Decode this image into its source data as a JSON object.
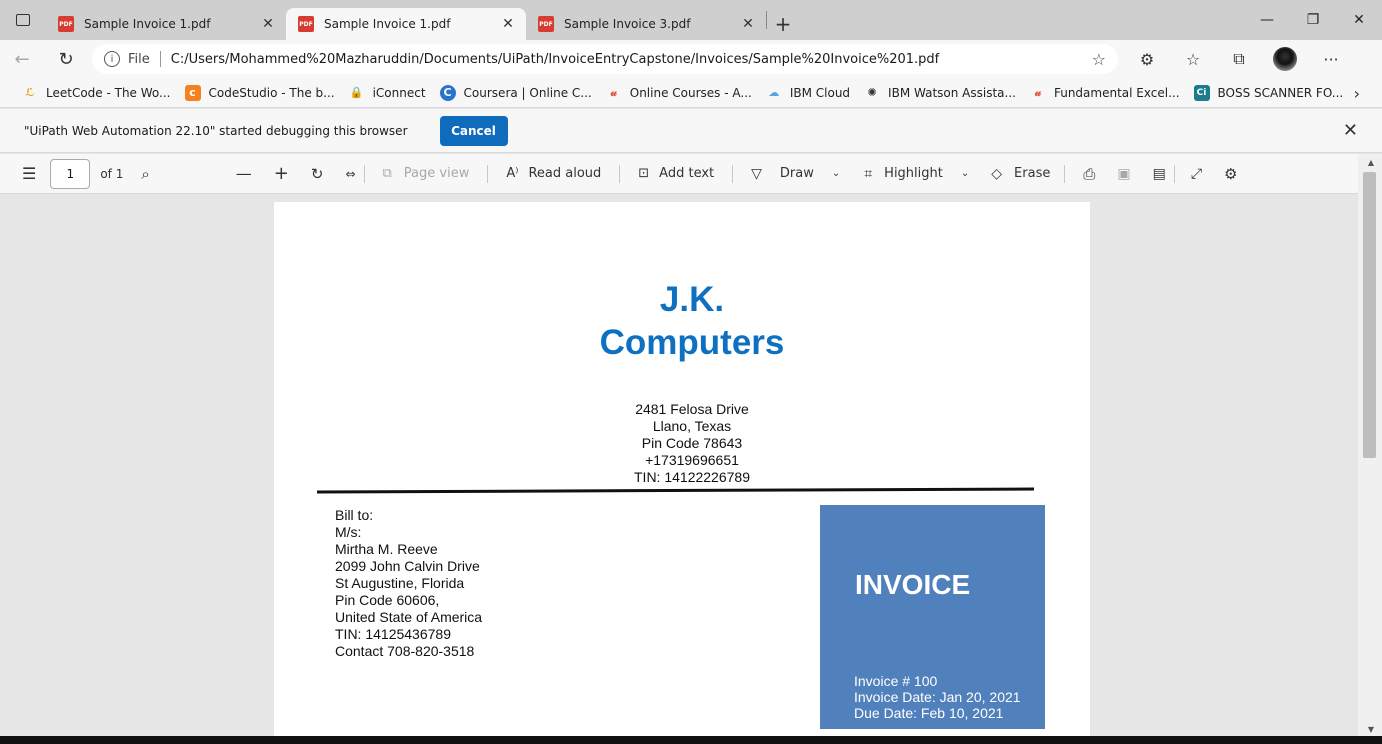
{
  "tabs": [
    {
      "title": "Sample Invoice 1.pdf",
      "active": false
    },
    {
      "title": "Sample Invoice 1.pdf",
      "active": true
    },
    {
      "title": "Sample Invoice 3.pdf",
      "active": false
    }
  ],
  "address": {
    "scheme_label": "File",
    "url": "C:/Users/Mohammed%20Mazharuddin/Documents/UiPath/InvoiceEntryCapstone/Invoices/Sample%20Invoice%201.pdf"
  },
  "bookmarks": [
    {
      "label": "LeetCode - The Wo...",
      "icon": "leetcode-icon"
    },
    {
      "label": "CodeStudio - The b...",
      "icon": "codestudio-icon"
    },
    {
      "label": "iConnect",
      "icon": "iconnect-icon"
    },
    {
      "label": "Coursera | Online C...",
      "icon": "coursera-icon"
    },
    {
      "label": "Online Courses - A...",
      "icon": "udemy-icon"
    },
    {
      "label": "IBM Cloud",
      "icon": "cloud-icon"
    },
    {
      "label": "IBM Watson Assista...",
      "icon": "watson-icon"
    },
    {
      "label": "Fundamental Excel...",
      "icon": "udemy-icon"
    },
    {
      "label": "BOSS SCANNER FO...",
      "icon": "ci-icon"
    }
  ],
  "infobar": {
    "message": "\"UiPath Web Automation 22.10\" started debugging this browser",
    "cancel_label": "Cancel"
  },
  "pdf_toolbar": {
    "page_number": "1",
    "page_total": "of 1",
    "page_view": "Page view",
    "read_aloud": "Read aloud",
    "add_text": "Add text",
    "draw": "Draw",
    "highlight": "Highlight",
    "erase": "Erase"
  },
  "invoice": {
    "company_line1": "J.K.",
    "company_line2": "Computers",
    "address": [
      "2481 Felosa Drive",
      "Llano, Texas",
      "Pin Code 78643",
      "+17319696651",
      "TIN: 14122226789"
    ],
    "bill_to": [
      "Bill to:",
      "M/s:",
      "Mirtha M. Reeve",
      "2099 John Calvin Drive",
      "St Augustine, Florida",
      "Pin Code  60606,",
      "United State of America",
      "TIN: 14125436789",
      "Contact 708-820-3518"
    ],
    "box_title": "INVOICE",
    "invoice_number": "Invoice # 100",
    "invoice_date": "Invoice Date: Jan 20, 2021",
    "due_date": "Due Date: Feb 10, 2021"
  },
  "colors": {
    "accent_blue": "#0f6cbd",
    "company_blue": "#0e70c0",
    "invoice_box": "#5181bd",
    "pdf_red": "#d83b30"
  }
}
